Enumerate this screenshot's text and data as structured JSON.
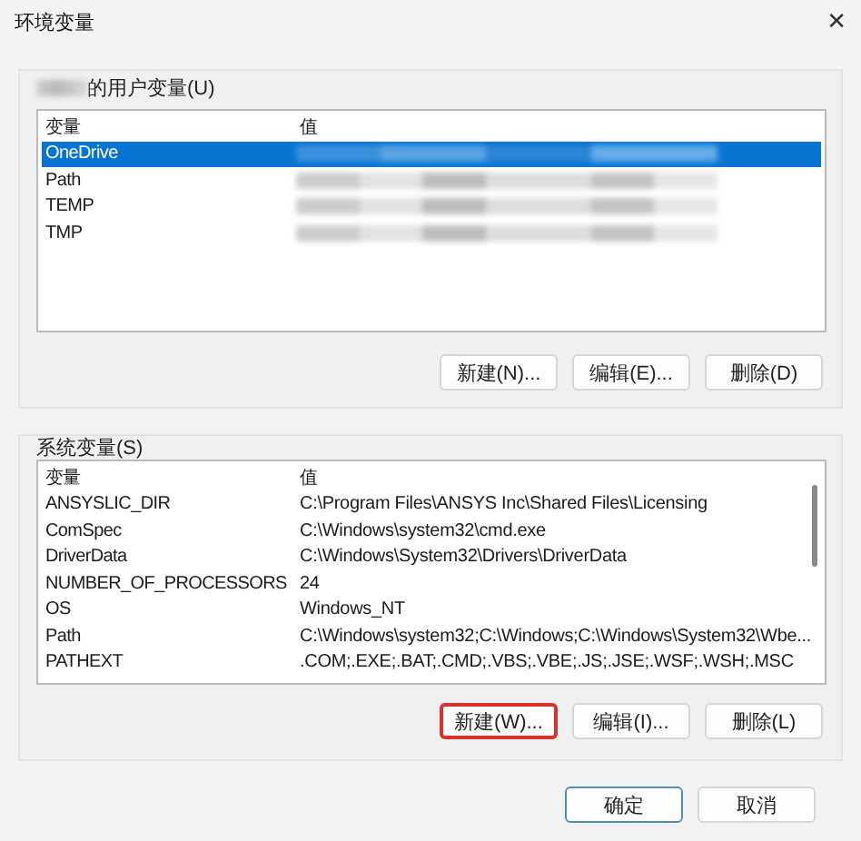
{
  "window": {
    "title": "环境变量",
    "close_icon": "✕"
  },
  "user_variables": {
    "label": {
      "name_redacted": true,
      "text": "的用户变量(U)"
    },
    "columns": [
      "变量",
      "值"
    ],
    "rows": [
      {
        "name": "OneDrive",
        "value_redacted": true,
        "selected": true
      },
      {
        "name": "Path",
        "value_redacted": true,
        "selected": false
      },
      {
        "name": "TEMP",
        "value_redacted": true,
        "selected": false
      },
      {
        "name": "TMP",
        "value_redacted": true,
        "selected": false
      }
    ],
    "buttons": [
      {
        "label": "新建(N)...",
        "highlighted": false
      },
      {
        "label": "编辑(E)...",
        "highlighted": false
      },
      {
        "label": "删除(D)",
        "highlighted": false
      }
    ]
  },
  "system_variables": {
    "label": {
      "text": "系统变量(S)"
    },
    "columns": [
      "变量",
      "值"
    ],
    "rows": [
      {
        "name": "ANSYSLIC_DIR",
        "value": "C:\\Program Files\\ANSYS Inc\\Shared Files\\Licensing",
        "selected": false
      },
      {
        "name": "ComSpec",
        "value": "C:\\Windows\\system32\\cmd.exe",
        "selected": false
      },
      {
        "name": "DriverData",
        "value": "C:\\Windows\\System32\\Drivers\\DriverData",
        "selected": false
      },
      {
        "name": "NUMBER_OF_PROCESSORS",
        "value": "24",
        "selected": false
      },
      {
        "name": "OS",
        "value": "Windows_NT",
        "selected": false
      },
      {
        "name": "Path",
        "value": "C:\\Windows\\system32;C:\\Windows;C:\\Windows\\System32\\Wbe...",
        "selected": false
      },
      {
        "name": "PATHEXT",
        "value": ".COM;.EXE;.BAT;.CMD;.VBS;.VBE;.JS;.JSE;.WSF;.WSH;.MSC",
        "selected": false
      }
    ],
    "buttons": [
      {
        "label": "新建(W)...",
        "highlighted": true
      },
      {
        "label": "编辑(I)...",
        "highlighted": false
      },
      {
        "label": "删除(L)",
        "highlighted": false
      }
    ]
  },
  "footer_buttons": [
    {
      "label": "确定",
      "default": true
    },
    {
      "label": "取消",
      "default": false
    }
  ]
}
